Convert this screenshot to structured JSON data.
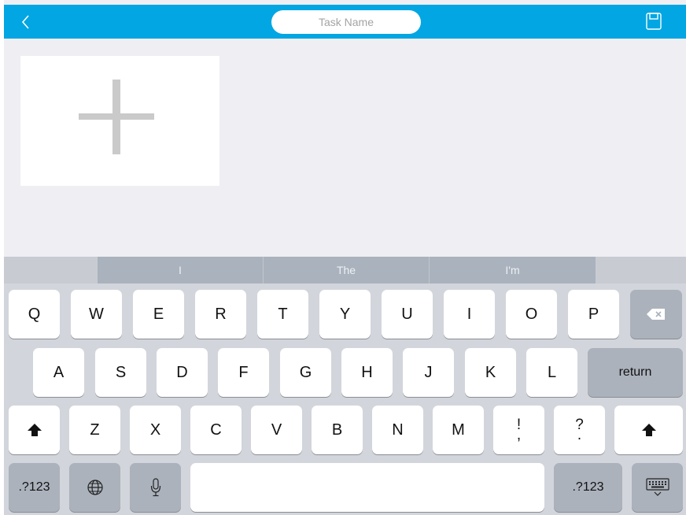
{
  "header": {
    "back_icon": "chevron-left-icon",
    "task_name_placeholder": "Task Name",
    "task_name_value": "",
    "save_icon": "save-icon"
  },
  "content": {
    "add_icon": "plus-icon"
  },
  "keyboard": {
    "suggestions": [
      "I",
      "The",
      "I'm"
    ],
    "row1": [
      "Q",
      "W",
      "E",
      "R",
      "T",
      "Y",
      "U",
      "I",
      "O",
      "P"
    ],
    "row2": [
      "A",
      "S",
      "D",
      "F",
      "G",
      "H",
      "J",
      "K",
      "L"
    ],
    "row3": [
      "Z",
      "X",
      "C",
      "V",
      "B",
      "N",
      "M"
    ],
    "exclaim_top": "!",
    "exclaim_bottom": ",",
    "question_top": "?",
    "question_bottom": ".",
    "return_label": "return",
    "numbers_label": ".?123",
    "backspace_icon": "backspace-icon",
    "shift_icon": "shift-icon",
    "globe_icon": "globe-icon",
    "mic_icon": "microphone-icon",
    "hide_keyboard_icon": "keyboard-hide-icon"
  },
  "colors": {
    "topbar": "#02a6e2",
    "background": "#eeeef3",
    "keyboard": "#d2d5db"
  }
}
